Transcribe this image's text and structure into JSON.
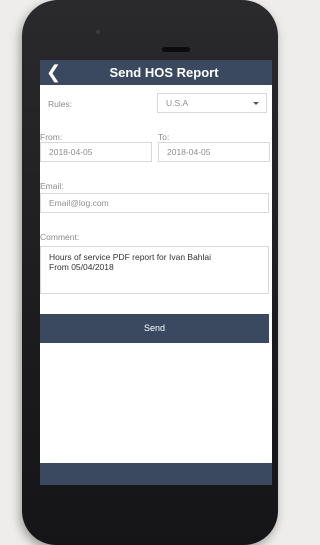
{
  "header": {
    "title": "Send HOS Report",
    "back_icon": "back-arrow-icon"
  },
  "rules": {
    "label": "Rules:",
    "value": "U.S.A"
  },
  "from": {
    "label": "From:",
    "value": "2018-04-05"
  },
  "to": {
    "label": "To:",
    "value": "2018-04-05"
  },
  "email": {
    "label": "Email:",
    "placeholder": "Email@log.com"
  },
  "comment": {
    "label": "Comment:",
    "value": "Hours of service PDF report for Ivan Bahlai\nFrom 05/04/2018"
  },
  "send_label": "Send",
  "colors": {
    "accent": "#3b4960",
    "background": "#ffffff"
  }
}
